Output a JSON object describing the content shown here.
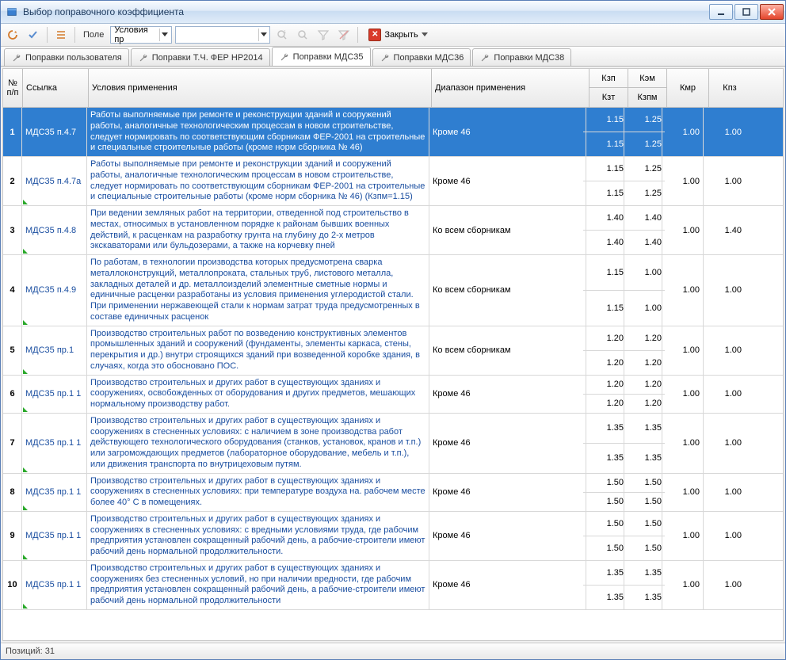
{
  "window": {
    "title": "Выбор поправочного коэффициента"
  },
  "toolbar": {
    "field_label": "Поле",
    "field_value": "Условия пр",
    "search_value": "",
    "close_label": "Закрыть"
  },
  "tabs": [
    {
      "label": "Поправки пользователя"
    },
    {
      "label": "Поправки Т.Ч. ФЕР НР2014"
    },
    {
      "label": "Поправки МДС35"
    },
    {
      "label": "Поправки МДС36"
    },
    {
      "label": "Поправки МДС38"
    }
  ],
  "active_tab": 2,
  "headers": {
    "no": "№\nп/п",
    "ref": "Ссылка",
    "cond": "Условия применения",
    "range": "Диапазон применения",
    "kzp": "Кзп",
    "kzt": "Кзт",
    "kem": "Кэм",
    "kzpm": "Кзпм",
    "kmr": "Кмр",
    "kpz": "Кпз"
  },
  "rows": [
    {
      "no": "1",
      "ref": "МДС35 п.4.7",
      "cond": "Работы выполняемые при ремонте и реконструкции зданий и сооружений работы, аналогичные технологическим процессам в новом строительстве, следует нормировать по соответствующим сборникам ФЕР-2001 на строительные и специальные строительные работы (кроме норм сборника № 46)",
      "range": "Кроме 46",
      "kzp": "1.15",
      "kzt": "1.15",
      "kem": "1.25",
      "kzpm": "1.25",
      "kmr": "1.00",
      "kpz": "1.00",
      "sel": true
    },
    {
      "no": "2",
      "ref": "МДС35 п.4.7а",
      "cond": "Работы выполняемые при ремонте и реконструкции зданий и сооружений работы, аналогичные технологическим процессам в новом строительстве, следует нормировать по соответствующим сборникам ФЕР-2001 на строительные и специальные строительные работы (кроме норм сборника № 46) (Кзпм=1.15)",
      "range": "Кроме 46",
      "kzp": "1.15",
      "kzt": "1.15",
      "kem": "1.25",
      "kzpm": "1.25",
      "kmr": "1.00",
      "kpz": "1.00"
    },
    {
      "no": "3",
      "ref": "МДС35 п.4.8",
      "cond": "При ведении земляных работ на территории, отведенной под строительство в местах, относимых в установленном порядке к районам бывших военных действий, к расценкам на разработку грунта на глубину до 2-х метров экскаваторами или бульдозерами, а также на корчевку пней",
      "range": "Ко всем сборникам",
      "kzp": "1.40",
      "kzt": "1.40",
      "kem": "1.40",
      "kzpm": "1.40",
      "kmr": "1.00",
      "kpz": "1.40"
    },
    {
      "no": "4",
      "ref": "МДС35 п.4.9",
      "cond": "По работам, в технологии производства которых предусмотрена сварка металлоконструкций, металлопроката, стальных труб, листового металла, закладных деталей и др. металлоизделий элементные сметные нормы и единичные расценки разработаны из условия применения углеродистой стали. При применении нержавеющей стали к нормам затрат труда предусмотренных в составе единичных расценок",
      "range": "Ко всем сборникам",
      "kzp": "1.15",
      "kzt": "1.15",
      "kem": "1.00",
      "kzpm": "1.00",
      "kmr": "1.00",
      "kpz": "1.00"
    },
    {
      "no": "5",
      "ref": "МДС35 пр.1",
      "cond": "Производство строительных работ по возведению конструктивных элементов промышленных зданий и сооружений (фундаменты, элементы каркаса, стены, перекрытия и др.) внутри строящихся зданий при возведенной коробке здания, в случаях, когда это обосновано ПОС.",
      "range": "Ко всем сборникам",
      "kzp": "1.20",
      "kzt": "1.20",
      "kem": "1.20",
      "kzpm": "1.20",
      "kmr": "1.00",
      "kpz": "1.00"
    },
    {
      "no": "6",
      "ref": "МДС35 пр.1 1",
      "cond": "Производство строительных и других работ в существующих зданиях и сооружениях, освобожденных от оборудования и других предметов, мешающих нормальному производству работ.",
      "range": "Кроме 46",
      "kzp": "1.20",
      "kzt": "1.20",
      "kem": "1.20",
      "kzpm": "1.20",
      "kmr": "1.00",
      "kpz": "1.00"
    },
    {
      "no": "7",
      "ref": "МДС35 пр.1 1",
      "cond": "Производство строительных и других работ в существующих зданиях и сооружениях в стесненных условиях: с наличием в зоне производства работ действующего технологического оборудования (станков, установок, кранов и т.п.) или загромождающих предметов (лабораторное оборудование, мебель и т.п.), или движения транспорта по внутрицеховым путям.",
      "range": "Кроме 46",
      "kzp": "1.35",
      "kzt": "1.35",
      "kem": "1.35",
      "kzpm": "1.35",
      "kmr": "1.00",
      "kpz": "1.00"
    },
    {
      "no": "8",
      "ref": "МДС35 пр.1 1",
      "cond": "Производство строительных и других работ в существующих зданиях и сооружениях в стесненных условиях: при температуре воздуха на. рабочем месте более 40° С в помещениях.",
      "range": "Кроме 46",
      "kzp": "1.50",
      "kzt": "1.50",
      "kem": "1.50",
      "kzpm": "1.50",
      "kmr": "1.00",
      "kpz": "1.00"
    },
    {
      "no": "9",
      "ref": "МДС35 пр.1 1",
      "cond": "Производство строительных и других работ в существующих зданиях и сооружениях в стесненных условиях: с вредными условиями труда, где рабочим предприятия установлен сокращенный рабочий день, а рабочие-строители имеют рабочий день нормальной продолжительности.",
      "range": "Кроме 46",
      "kzp": "1.50",
      "kzt": "1.50",
      "kem": "1.50",
      "kzpm": "1.50",
      "kmr": "1.00",
      "kpz": "1.00"
    },
    {
      "no": "10",
      "ref": "МДС35 пр.1 1",
      "cond": "Производство строительных и других работ в существующих зданиях и сооружениях без стесненных условий, но при наличии вредности, где рабочим предприятия установлен сокращенный рабочий день, а рабочие-строители имеют рабочий день нормальной продолжительности",
      "range": "Кроме 46",
      "kzp": "1.35",
      "kzt": "1.35",
      "kem": "1.35",
      "kzpm": "1.35",
      "kmr": "1.00",
      "kpz": "1.00"
    }
  ],
  "status": {
    "count_label": "Позиций:",
    "count": "31"
  }
}
